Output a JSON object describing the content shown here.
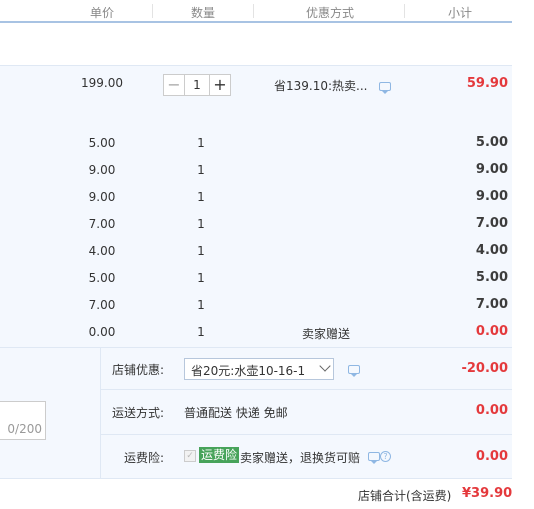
{
  "header": {
    "price": "单价",
    "quantity": "数量",
    "promo": "优惠方式",
    "subtotal": "小计"
  },
  "main_item": {
    "price": "199.00",
    "quantity": "1",
    "decrement": "−",
    "increment": "+",
    "promo": "省139.10:热卖...",
    "subtotal": "59.90"
  },
  "gift_rows": [
    {
      "price": "5.00",
      "qty": "1",
      "promo": "",
      "subtotal": "5.00"
    },
    {
      "price": "9.00",
      "qty": "1",
      "promo": "",
      "subtotal": "9.00"
    },
    {
      "price": "9.00",
      "qty": "1",
      "promo": "",
      "subtotal": "9.00"
    },
    {
      "price": "7.00",
      "qty": "1",
      "promo": "",
      "subtotal": "7.00"
    },
    {
      "price": "4.00",
      "qty": "1",
      "promo": "",
      "subtotal": "4.00"
    },
    {
      "price": "5.00",
      "qty": "1",
      "promo": "",
      "subtotal": "5.00"
    },
    {
      "price": "7.00",
      "qty": "1",
      "promo": "",
      "subtotal": "7.00"
    },
    {
      "price": "0.00",
      "qty": "1",
      "promo": "卖家赠送",
      "subtotal": "0.00"
    }
  ],
  "store_discount": {
    "label": "店铺优惠:",
    "selected": "省20元:水壶10-16-1",
    "amount": "-20.00"
  },
  "shipping": {
    "label": "运送方式:",
    "value": "普通配送 快递 免邮",
    "amount": "0.00"
  },
  "freight_insurance": {
    "label": "运费险:",
    "badge": "运费险",
    "description": "卖家赠送，退换货可赔",
    "amount": "0.00"
  },
  "message": {
    "counter": "0/200"
  },
  "store_total": {
    "label": "店铺合计(含运费)",
    "amount": "¥39.90"
  },
  "colors": {
    "accent_red": "#e4393c",
    "header_border": "#a8c3e3",
    "panel_bg": "#f4f8fe",
    "badge_green": "#47a35a"
  }
}
